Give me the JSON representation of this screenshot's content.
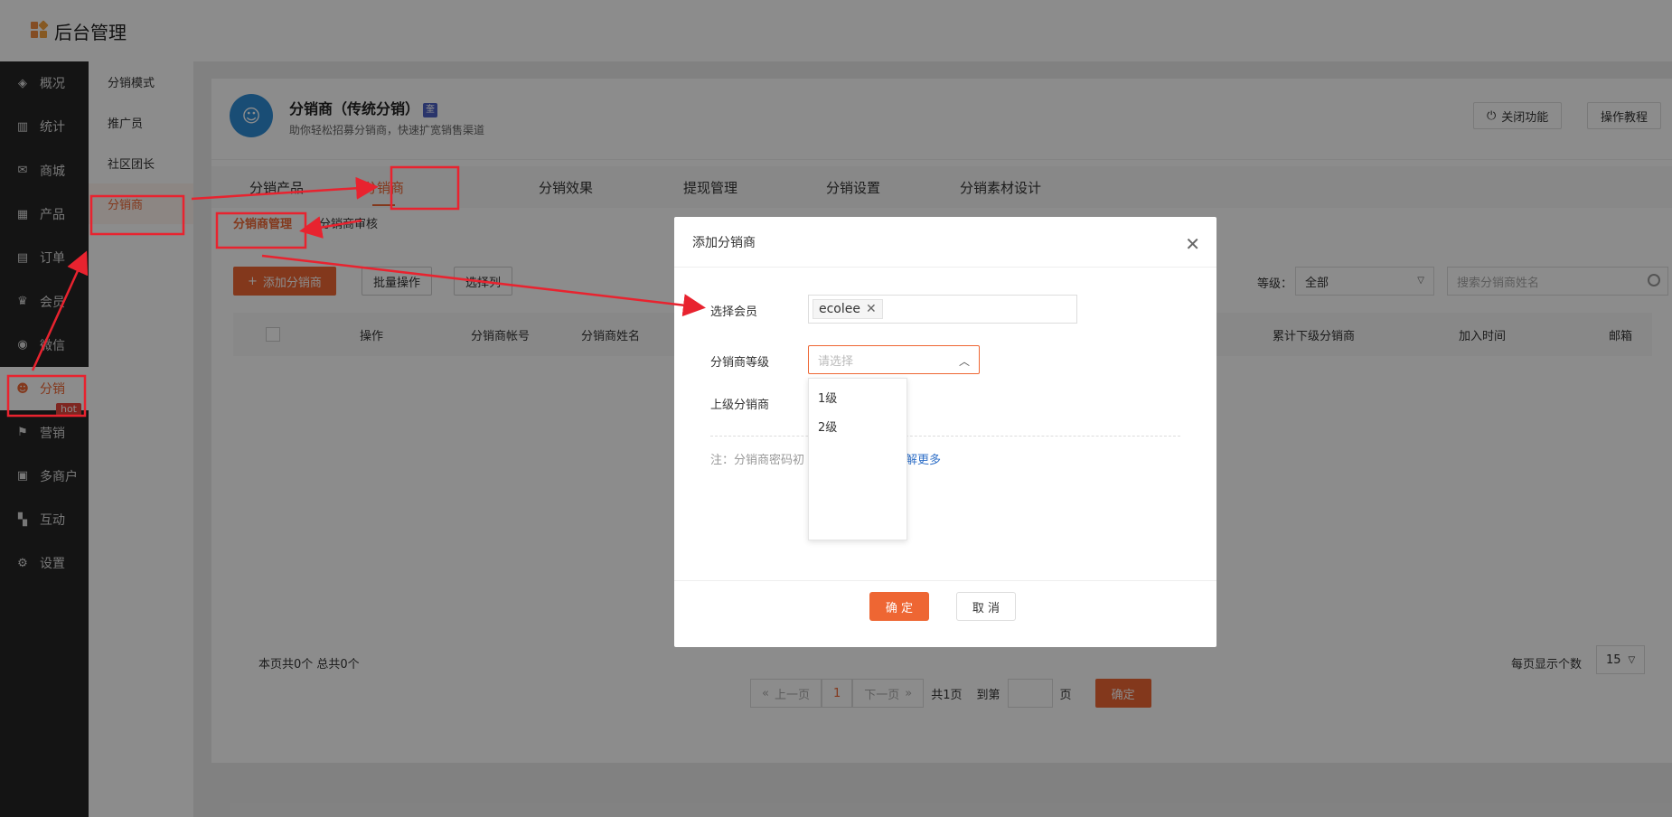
{
  "app": {
    "title": "后台管理"
  },
  "sidebar": {
    "items": [
      {
        "label": "概况",
        "icon": "layers-icon",
        "glyph": "◈"
      },
      {
        "label": "统计",
        "icon": "chart-icon",
        "glyph": "▥"
      },
      {
        "label": "商城",
        "icon": "mail-icon",
        "glyph": "✉"
      },
      {
        "label": "产品",
        "icon": "grid-icon",
        "glyph": "▦"
      },
      {
        "label": "订单",
        "icon": "clipboard-icon",
        "glyph": "▤"
      },
      {
        "label": "会员",
        "icon": "crown-icon",
        "glyph": "♛"
      },
      {
        "label": "微信",
        "icon": "wechat-icon",
        "glyph": "◉"
      },
      {
        "label": "分销",
        "icon": "users-icon",
        "glyph": "☻",
        "active": true,
        "badge": "hot"
      },
      {
        "label": "营销",
        "icon": "flag-icon",
        "glyph": "⚑"
      },
      {
        "label": "多商户",
        "icon": "store-icon",
        "glyph": "▣"
      },
      {
        "label": "互动",
        "icon": "apps-icon",
        "glyph": "▚"
      },
      {
        "label": "设置",
        "icon": "gear-icon",
        "glyph": "⚙"
      }
    ]
  },
  "subsidebar": {
    "items": [
      {
        "label": "分销模式"
      },
      {
        "label": "推广员"
      },
      {
        "label": "社区团长"
      },
      {
        "label": "分销商",
        "active": true
      }
    ]
  },
  "header": {
    "title": "分销商（传统分销）",
    "badge": "奎",
    "subtitle": "助你轻松招募分销商，快速扩宽销售渠道",
    "close_btn": "关闭功能",
    "tutorial_btn": "操作教程"
  },
  "tabs": [
    "分销产品",
    "分销商",
    "分销效果",
    "提现管理",
    "分销设置",
    "分销素材设计"
  ],
  "subtabs": [
    "分销商管理",
    "分销商审核"
  ],
  "toolbar": {
    "add_btn": "添加分销商",
    "batch_btn": "批量操作",
    "cols_btn": "选择列",
    "level_label": "等级：",
    "level_value": "全部",
    "search_placeholder": "搜索分销商姓名"
  },
  "table": {
    "headers": [
      "操作",
      "分销商帐号",
      "分销商姓名",
      "累计下级分销商",
      "加入时间",
      "邮箱"
    ]
  },
  "footer": {
    "info": "本页共0个  总共0个",
    "per_page_label": "每页显示个数",
    "per_page_value": "15",
    "prev": "上一页",
    "cur": "1",
    "next": "下一页",
    "total_pages": "共1页",
    "goto": "到第",
    "page_unit": "页",
    "ok": "确定"
  },
  "dialog": {
    "title": "添加分销商",
    "member_label": "选择会员",
    "member_tag": "ecolee",
    "level_label": "分销商等级",
    "level_placeholder": "请选择",
    "level_options": [
      "1级",
      "2级"
    ],
    "parent_label": "上级分销商",
    "note": "注：分销商密码初",
    "note_link": "解更多",
    "ok": "确 定",
    "cancel": "取 消"
  },
  "colors": {
    "accent": "#ee6633",
    "annotation": "#e8232f",
    "sidebar": "#262626"
  }
}
